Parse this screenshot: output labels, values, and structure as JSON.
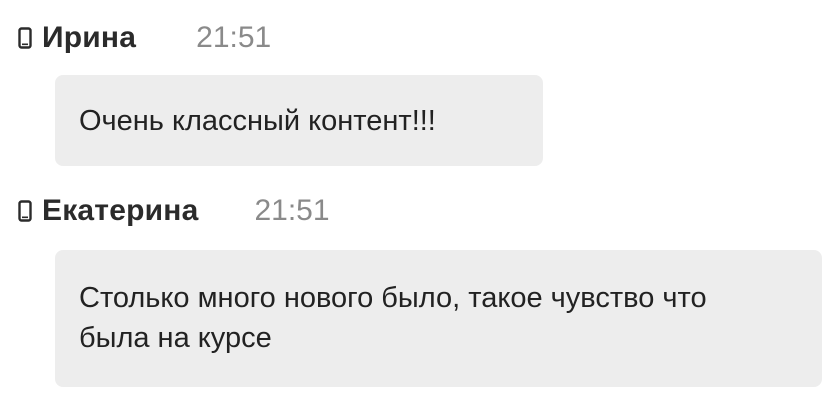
{
  "messages": [
    {
      "author": "Ирина",
      "time": "21:51",
      "text": "Очень классный контент!!!",
      "device_icon": "mobile-phone-icon"
    },
    {
      "author": "Екатерина",
      "time": "21:51",
      "text": "Столько много нового было, такое чувство что была на курсе",
      "device_icon": "mobile-phone-icon"
    }
  ],
  "colors": {
    "bubble_bg": "#ededed",
    "author_text": "#2b2b2b",
    "time_text": "#8a8a8a",
    "message_text": "#222222"
  }
}
